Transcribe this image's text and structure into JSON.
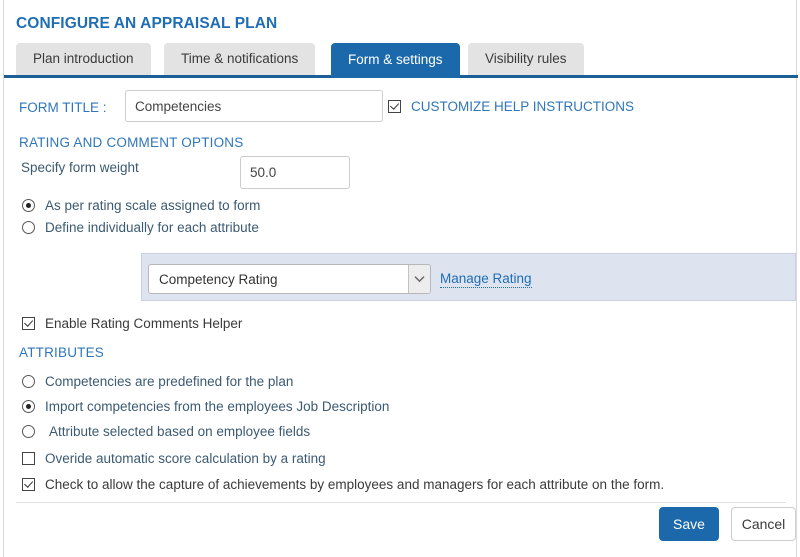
{
  "page": {
    "title": "CONFIGURE AN APPRAISAL PLAN"
  },
  "tabs": [
    {
      "label": "Plan introduction",
      "active": false
    },
    {
      "label": "Time & notifications",
      "active": false
    },
    {
      "label": "Form & settings",
      "active": true
    },
    {
      "label": "Visibility rules",
      "active": false
    }
  ],
  "form": {
    "form_title_label": "FORM TITLE :",
    "form_title_value": "Competencies",
    "form_title_placeholder": "",
    "customize_help_label": "CUSTOMIZE HELP INSTRUCTIONS",
    "customize_help_checked": true
  },
  "rating_section": {
    "heading": "RATING AND COMMENT OPTIONS",
    "weight_label": "Specify form weight",
    "weight_value": "50.0",
    "weight_placeholder": "",
    "options": [
      {
        "label": "As per rating scale assigned to form",
        "selected": true
      },
      {
        "label": "Define individually for each attribute",
        "selected": false
      }
    ],
    "rating_select_value": "Competency Rating",
    "manage_rating_link": "Manage Rating",
    "comments_helper_label": "Enable Rating Comments Helper",
    "comments_helper_checked": true
  },
  "attributes_section": {
    "heading": "ATTRIBUTES",
    "options": [
      {
        "label": "Competencies are predefined for the plan",
        "selected": false
      },
      {
        "label": "Import competencies from the employees Job Description",
        "selected": true
      },
      {
        "label": "Attribute selected based on employee fields",
        "selected": false
      }
    ],
    "checkboxes": [
      {
        "label": "Overide automatic score calculation by a rating",
        "checked": false
      },
      {
        "label": "Check to allow the capture of achievements by employees and managers for each attribute on the form.",
        "checked": true
      }
    ]
  },
  "footer": {
    "save_label": "Save",
    "cancel_label": "Cancel"
  },
  "colors": {
    "accent_blue": "#1b69ab",
    "heading_blue": "#2f76bb",
    "title_blue": "#1f6eb5",
    "tab_inactive": "#e3e3e3",
    "panel_blue": "#dde4f0",
    "tabbar_border": "#1c5f96"
  }
}
